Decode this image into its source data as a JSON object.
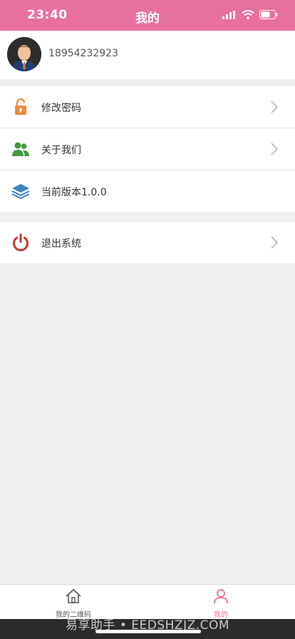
{
  "status_bar": {
    "time": "23:40"
  },
  "nav": {
    "title": "我的"
  },
  "profile": {
    "phone": "18954232923"
  },
  "menu_group_1": [
    {
      "label": "修改密码",
      "icon": "lock-icon",
      "has_arrow": true
    },
    {
      "label": "关于我们",
      "icon": "users-icon",
      "has_arrow": true
    },
    {
      "label": "当前版本1.0.0",
      "icon": "layers-icon",
      "has_arrow": false
    }
  ],
  "menu_group_2": [
    {
      "label": "退出系统",
      "icon": "power-icon",
      "has_arrow": true
    }
  ],
  "tabbar": {
    "tabs": [
      {
        "label": "我的二维码",
        "icon": "home-icon",
        "active": false
      },
      {
        "label": "我的",
        "icon": "person-icon",
        "active": true
      }
    ]
  },
  "watermark": "易享助手 • EEDSHZJZ.COM",
  "colors": {
    "brand_pink": "#e8709c",
    "lock_orange": "#f0883a",
    "users_green": "#3f9a3c",
    "layers_blue": "#3b82c4",
    "power_red": "#c8382b"
  }
}
